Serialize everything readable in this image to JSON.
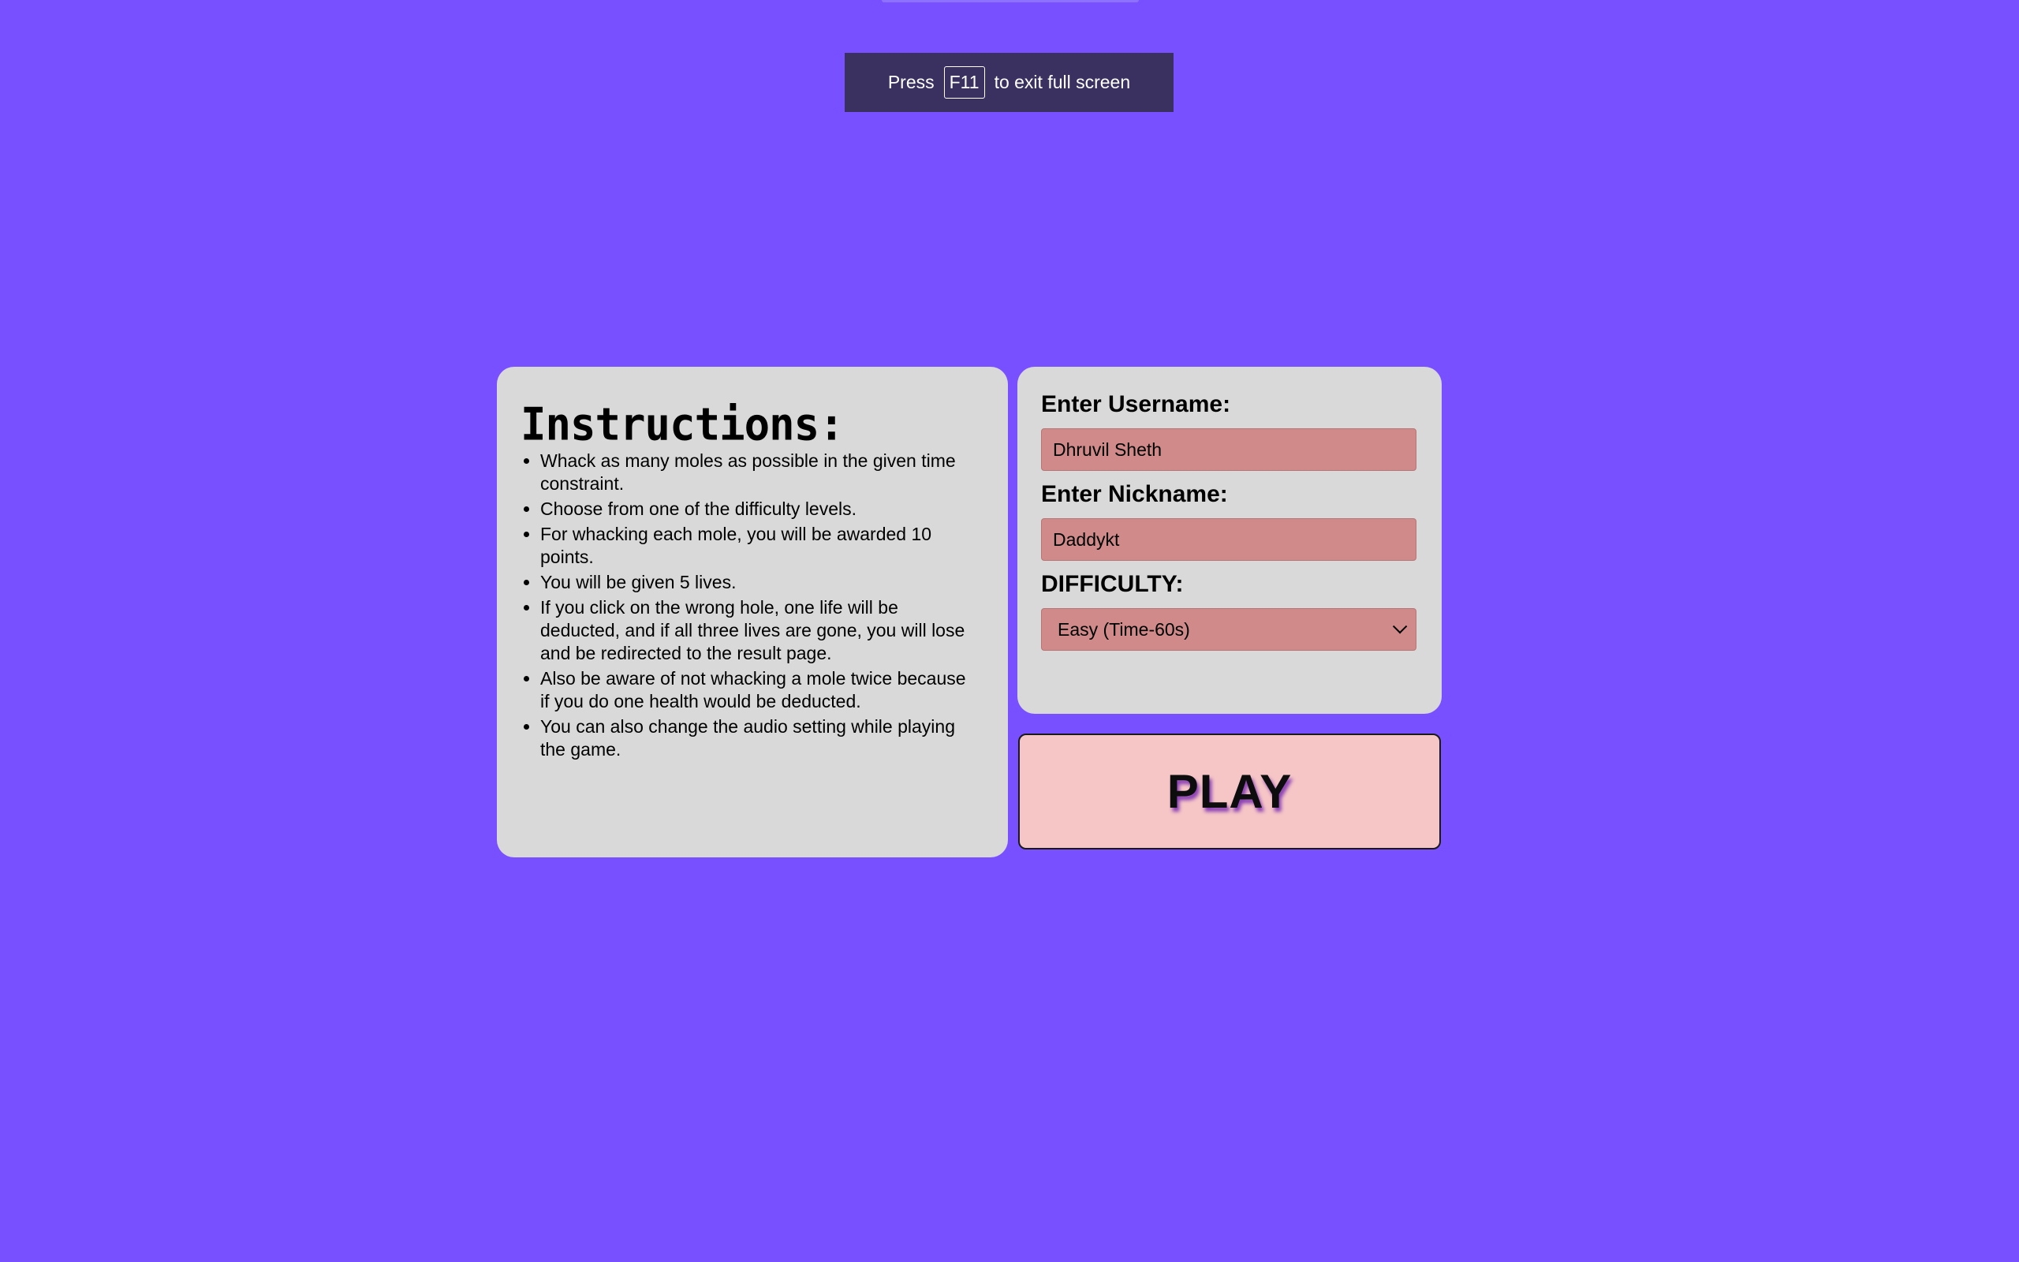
{
  "fullscreen_banner": {
    "prefix": "Press",
    "key": "F11",
    "suffix": "to exit full screen"
  },
  "instructions": {
    "title": "Instructions:",
    "items": [
      "Whack as many moles as possible in the given time constraint.",
      "Choose from one of the difficulty levels.",
      "For whacking each mole, you will be awarded 10 points.",
      "You will be given 5 lives.",
      "If you click on the wrong hole, one life will be deducted, and if all three lives are gone, you will lose and be redirected to the result page.",
      "Also be aware of not whacking a mole twice because if you do one health would be deducted.",
      "You can also change the audio setting while playing the game."
    ]
  },
  "form": {
    "username_label": "Enter Username:",
    "username_value": "Dhruvil Sheth",
    "nickname_label": "Enter Nickname:",
    "nickname_value": "Daddykt",
    "difficulty_label": "DIFFICULTY:",
    "difficulty_selected": "Easy (Time-60s)"
  },
  "play_label": "PLAY",
  "colors": {
    "background": "#7850ff",
    "card": "#d9d9d9",
    "field": "#cf8a89",
    "play_button": "#f6c6c6",
    "banner": "#3a3160"
  },
  "icons": {
    "difficulty_dropdown": "chevron-down-icon"
  }
}
